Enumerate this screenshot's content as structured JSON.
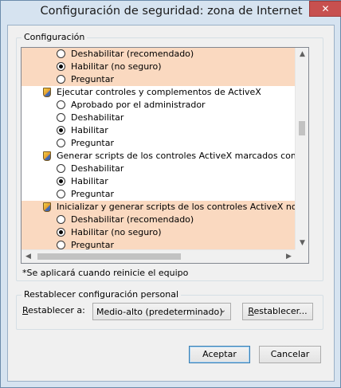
{
  "window": {
    "title": "Configuración de seguridad: zona de Internet",
    "close_glyph": "✕"
  },
  "settings_group": {
    "title": "Configuración"
  },
  "settings_list": {
    "rows": [
      {
        "kind": "option",
        "label": "Deshabilitar (recomendado)",
        "selected": false,
        "highlight": true
      },
      {
        "kind": "option",
        "label": "Habilitar (no seguro)",
        "selected": true,
        "highlight": true
      },
      {
        "kind": "option",
        "label": "Preguntar",
        "selected": false,
        "highlight": true
      },
      {
        "kind": "category",
        "label": "Ejecutar controles y complementos de ActiveX",
        "highlight": false
      },
      {
        "kind": "option",
        "label": "Aprobado por el administrador",
        "selected": false,
        "highlight": false
      },
      {
        "kind": "option",
        "label": "Deshabilitar",
        "selected": false,
        "highlight": false
      },
      {
        "kind": "option",
        "label": "Habilitar",
        "selected": true,
        "highlight": false
      },
      {
        "kind": "option",
        "label": "Preguntar",
        "selected": false,
        "highlight": false
      },
      {
        "kind": "category",
        "label": "Generar scripts de los controles ActiveX marcados como segu",
        "highlight": false
      },
      {
        "kind": "option",
        "label": "Deshabilitar",
        "selected": false,
        "highlight": false
      },
      {
        "kind": "option",
        "label": "Habilitar",
        "selected": true,
        "highlight": false
      },
      {
        "kind": "option",
        "label": "Preguntar",
        "selected": false,
        "highlight": false
      },
      {
        "kind": "category",
        "label": "Inicializar y generar scripts de los controles ActiveX no marca",
        "highlight": true
      },
      {
        "kind": "option",
        "label": "Deshabilitar (recomendado)",
        "selected": false,
        "highlight": true
      },
      {
        "kind": "option",
        "label": "Habilitar (no seguro)",
        "selected": true,
        "highlight": true
      },
      {
        "kind": "option",
        "label": "Preguntar",
        "selected": false,
        "highlight": true
      }
    ],
    "scroll_up_glyph": "▲",
    "scroll_down_glyph": "▼",
    "scroll_left_glyph": "◀",
    "scroll_right_glyph": "▶"
  },
  "restart_note": "*Se aplicará cuando reinicie el equipo",
  "reset_group": {
    "title": "Restablecer configuración personal",
    "label_mnemonic": "R",
    "label_rest": "establecer a:",
    "select_value": "Medio-alto (predeterminado)",
    "select_arrow": "⌄",
    "reset_button_mnemonic": "R",
    "reset_button_rest": "establecer..."
  },
  "buttons": {
    "ok": "Aceptar",
    "cancel": "Cancelar"
  },
  "colors": {
    "highlight": "#fad9c0",
    "close": "#c7504f"
  }
}
